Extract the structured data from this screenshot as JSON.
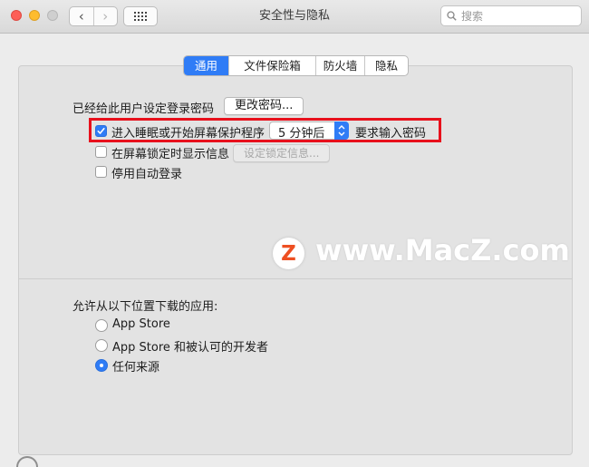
{
  "window": {
    "title": "安全性与隐私",
    "search_placeholder": "搜索"
  },
  "tabs": [
    {
      "label": "通用",
      "active": true
    },
    {
      "label": "文件保险箱",
      "active": false
    },
    {
      "label": "防火墙",
      "active": false
    },
    {
      "label": "隐私",
      "active": false
    }
  ],
  "general": {
    "password_set_label": "已经给此用户设定登录密码",
    "change_password_button": "更改密码...",
    "require_password": {
      "checked": true,
      "label_before": "进入睡眠或开始屏幕保护程序",
      "delay_value": "5 分钟后",
      "label_after": "要求输入密码"
    },
    "show_message": {
      "checked": false,
      "label": "在屏幕锁定时显示信息",
      "button": "设定锁定信息..."
    },
    "disable_auto_login": {
      "checked": false,
      "label": "停用自动登录"
    }
  },
  "downloads": {
    "heading": "允许从以下位置下载的应用:",
    "options": [
      {
        "label": "App Store",
        "selected": false
      },
      {
        "label": "App Store 和被认可的开发者",
        "selected": false
      },
      {
        "label": "任何来源",
        "selected": true
      }
    ]
  },
  "watermark": {
    "logo_letter": "Z",
    "text": "www.MacZ.com"
  },
  "colors": {
    "accent": "#2f7cf6",
    "highlight_box": "#e8101c",
    "watermark_logo": "#ee4f22"
  }
}
